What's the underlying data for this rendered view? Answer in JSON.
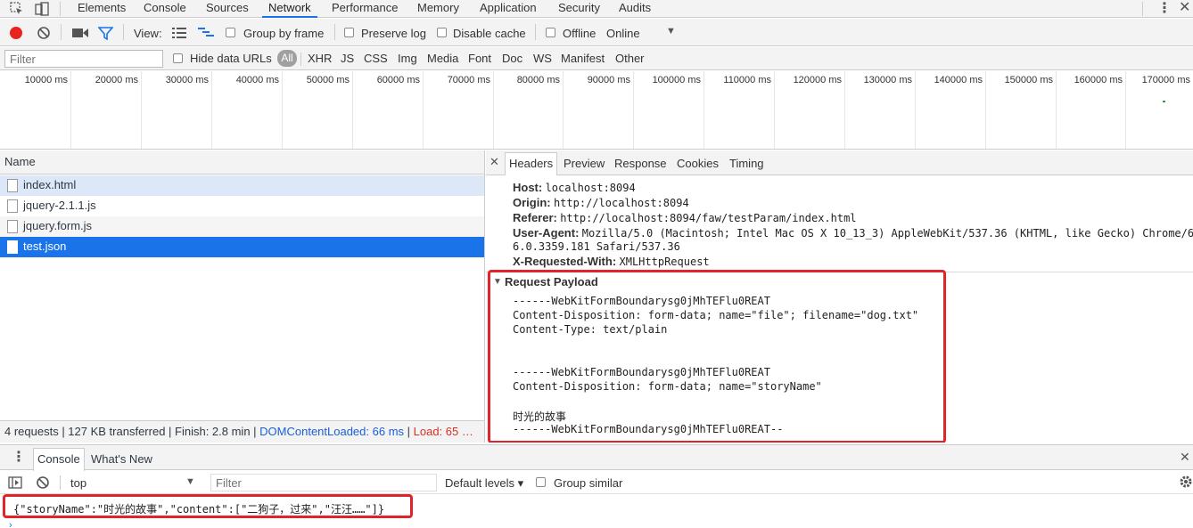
{
  "devtools_tabs": [
    "Elements",
    "Console",
    "Sources",
    "Network",
    "Performance",
    "Memory",
    "Application",
    "Security",
    "Audits"
  ],
  "toolbar": {
    "view_label": "View:",
    "group_by_frame": "Group by frame",
    "preserve_log": "Preserve log",
    "disable_cache": "Disable cache",
    "offline": "Offline",
    "throttle_value": "Online"
  },
  "filterbar": {
    "filter_placeholder": "Filter",
    "hide_data_urls": "Hide data URLs",
    "all": "All",
    "types": [
      "XHR",
      "JS",
      "CSS",
      "Img",
      "Media",
      "Font",
      "Doc",
      "WS",
      "Manifest",
      "Other"
    ]
  },
  "timeline": {
    "ticks": [
      "10000 ms",
      "20000 ms",
      "30000 ms",
      "40000 ms",
      "50000 ms",
      "60000 ms",
      "70000 ms",
      "80000 ms",
      "90000 ms",
      "100000 ms",
      "110000 ms",
      "120000 ms",
      "130000 ms",
      "140000 ms",
      "150000 ms",
      "160000 ms",
      "170000 ms"
    ]
  },
  "requests": {
    "header": "Name",
    "items": [
      "index.html",
      "jquery-2.1.1.js",
      "jquery.form.js",
      "test.json"
    ]
  },
  "status": {
    "summary": "4 requests | 127 KB transferred | Finish: 2.8 min | ",
    "dom_loaded": "DOMContentLoaded: 66 ms",
    "sep": " | ",
    "load": "Load: 65 …"
  },
  "detail_tabs": [
    "Headers",
    "Preview",
    "Response",
    "Cookies",
    "Timing"
  ],
  "headers": [
    {
      "k": "Host:",
      "v": "localhost:8094"
    },
    {
      "k": "Origin:",
      "v": "http://localhost:8094"
    },
    {
      "k": "Referer:",
      "v": "http://localhost:8094/faw/testParam/index.html"
    },
    {
      "k": "User-Agent:",
      "v": "Mozilla/5.0 (Macintosh; Intel Mac OS X 10_13_3) AppleWebKit/537.36 (KHTML, like Gecko) Chrome/6"
    },
    {
      "k": "",
      "v": "6.0.3359.181 Safari/537.36"
    },
    {
      "k": "X-Requested-With:",
      "v": "XMLHttpRequest"
    }
  ],
  "payload": {
    "title": "Request Payload",
    "lines": [
      "------WebKitFormBoundarysg0jMhTEFlu0REAT",
      "Content-Disposition: form-data; name=\"file\"; filename=\"dog.txt\"",
      "Content-Type: text/plain",
      "",
      "",
      "------WebKitFormBoundarysg0jMhTEFlu0REAT",
      "Content-Disposition: form-data; name=\"storyName\"",
      "",
      "时光的故事",
      "------WebKitFormBoundarysg0jMhTEFlu0REAT--"
    ]
  },
  "drawer": {
    "tabs": [
      "Console",
      "What's New"
    ],
    "context": "top",
    "filter_placeholder": "Filter",
    "levels": "Default levels ▾",
    "group_similar": "Group similar",
    "output": "{\"storyName\":\"时光的故事\",\"content\":[\"二狗子，过来\",\"汪汪……\"]}"
  },
  "colors": {
    "accent": "#1a73e8",
    "record": "#e8231e",
    "highlight_box": "#e0242a"
  }
}
